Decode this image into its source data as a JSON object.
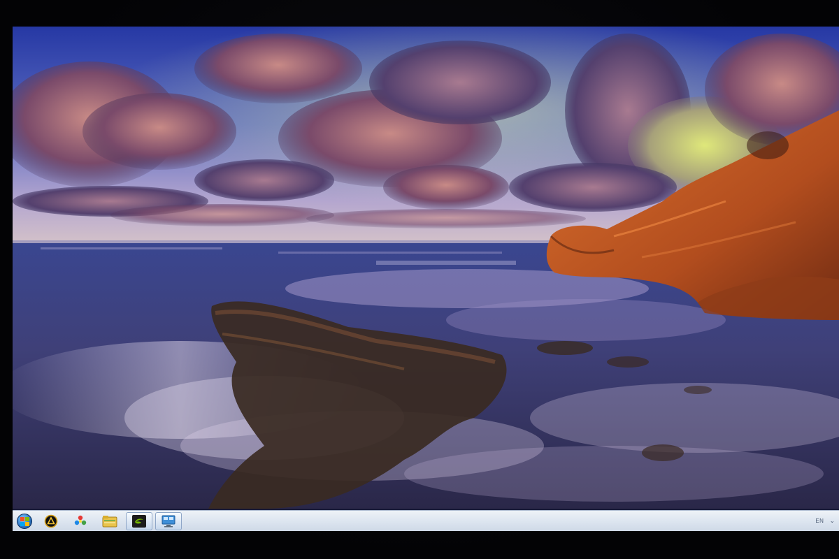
{
  "desktop": {
    "wallpaper": {
      "description_icon": "coastal-sunset-wallpaper",
      "colors": {
        "sky_top": "#2a3aa8",
        "sky_mid": "#6a78c8",
        "horizon": "#c7b6c9",
        "sea": "#3b3d78",
        "rock": "#c25a22",
        "foam": "#d9cbe4"
      }
    }
  },
  "taskbar": {
    "start_icon": "windows-start-orb",
    "pinned_items": [
      {
        "name": "app-triangle-icon",
        "icon": "circle-triangle-icon"
      },
      {
        "name": "app-wheel-icon",
        "icon": "colorful-wheel-icon"
      },
      {
        "name": "explorer-icon",
        "icon": "folder-icon"
      },
      {
        "name": "nvidia-icon",
        "icon": "nvidia-logo-icon"
      },
      {
        "name": "network-app-icon",
        "icon": "monitor-network-icon"
      }
    ],
    "tray": {
      "language": "EN",
      "chevron": "⌄"
    },
    "colors": {
      "bar_top": "#eef2f7",
      "bar_bottom": "#cfd9e7",
      "border": "#aebbd0"
    }
  }
}
